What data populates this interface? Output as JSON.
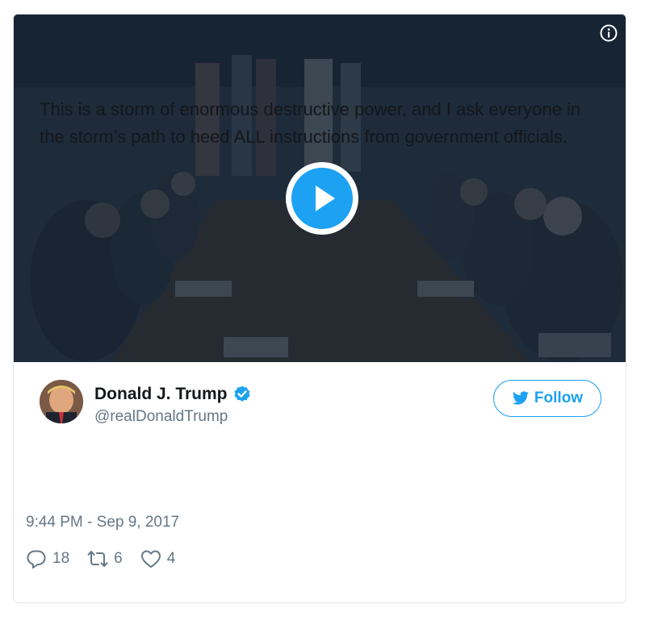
{
  "media": {
    "info_icon": "info-icon",
    "play_icon": "play-icon",
    "colors": {
      "play_bg": "#1da1f2",
      "overlay": "#162638"
    }
  },
  "author": {
    "name": "Donald J. Trump",
    "handle": "@realDonaldTrump",
    "verified_icon": "verified-badge-icon",
    "follow_label": "Follow",
    "follow_icon": "twitter-bird-icon"
  },
  "tweet": {
    "text": "This is a storm of enormous destructive power, and I ask everyone in the storm’s path to heed ALL instructions from government officials.",
    "timestamp": "9:44 PM - Sep 9, 2017"
  },
  "actions": {
    "replies": {
      "icon": "reply-icon",
      "count": "18"
    },
    "retweets": {
      "icon": "retweet-icon",
      "count": "6"
    },
    "likes": {
      "icon": "heart-icon",
      "count": "4"
    }
  },
  "colors": {
    "accent": "#1da1f2",
    "text": "#14171a",
    "muted": "#657786",
    "border": "#e1e8ed"
  }
}
